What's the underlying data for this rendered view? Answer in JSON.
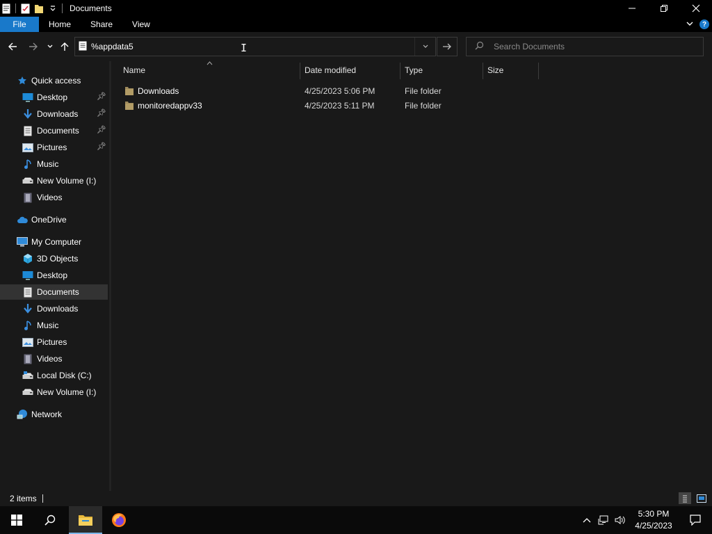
{
  "window": {
    "title": "Documents"
  },
  "ribbon": {
    "tabs": [
      "File",
      "Home",
      "Share",
      "View"
    ],
    "help": "?"
  },
  "address": {
    "value": "%appdata5"
  },
  "search": {
    "placeholder": "Search Documents"
  },
  "sidebar": {
    "quick_access": "Quick access",
    "quick_items": [
      "Desktop",
      "Downloads",
      "Documents",
      "Pictures",
      "Music",
      "New Volume (I:)",
      "Videos"
    ],
    "onedrive": "OneDrive",
    "my_computer": "My Computer",
    "computer_items": [
      "3D Objects",
      "Desktop",
      "Documents",
      "Downloads",
      "Music",
      "Pictures",
      "Videos",
      "Local Disk (C:)",
      "New Volume (I:)"
    ],
    "network": "Network",
    "selected": "Documents"
  },
  "columns": [
    "Name",
    "Date modified",
    "Type",
    "Size"
  ],
  "files": [
    {
      "name": "Downloads",
      "date": "4/25/2023 5:06 PM",
      "type": "File folder",
      "size": ""
    },
    {
      "name": "monitoredappv33",
      "date": "4/25/2023 5:11 PM",
      "type": "File folder",
      "size": ""
    }
  ],
  "status": {
    "item_count": "2 items"
  },
  "taskbar": {
    "time": "5:30 PM",
    "date": "4/25/2023"
  },
  "colors": {
    "accent": "#1979ca",
    "background": "#191919",
    "folder": "#9e8a5c",
    "selection": "#333333"
  }
}
